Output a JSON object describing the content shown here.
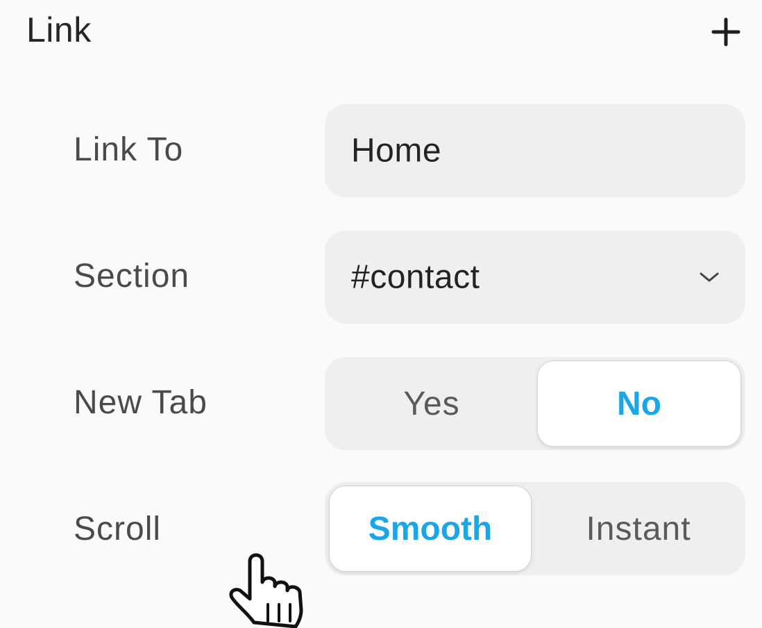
{
  "panel": {
    "title": "Link",
    "add_icon": "plus-icon"
  },
  "rows": {
    "link_to": {
      "label": "Link To",
      "value": "Home"
    },
    "section": {
      "label": "Section",
      "value": "#contact",
      "icon": "chevron-down-icon"
    },
    "new_tab": {
      "label": "New Tab",
      "options": [
        "Yes",
        "No"
      ],
      "selected": "No"
    },
    "scroll": {
      "label": "Scroll",
      "options": [
        "Smooth",
        "Instant"
      ],
      "selected": "Smooth"
    }
  },
  "cursor": {
    "icon": "hand-pointer-icon"
  },
  "colors": {
    "accent": "#1aa6e8",
    "field_bg": "#efefef",
    "page_bg": "#fafafa"
  }
}
